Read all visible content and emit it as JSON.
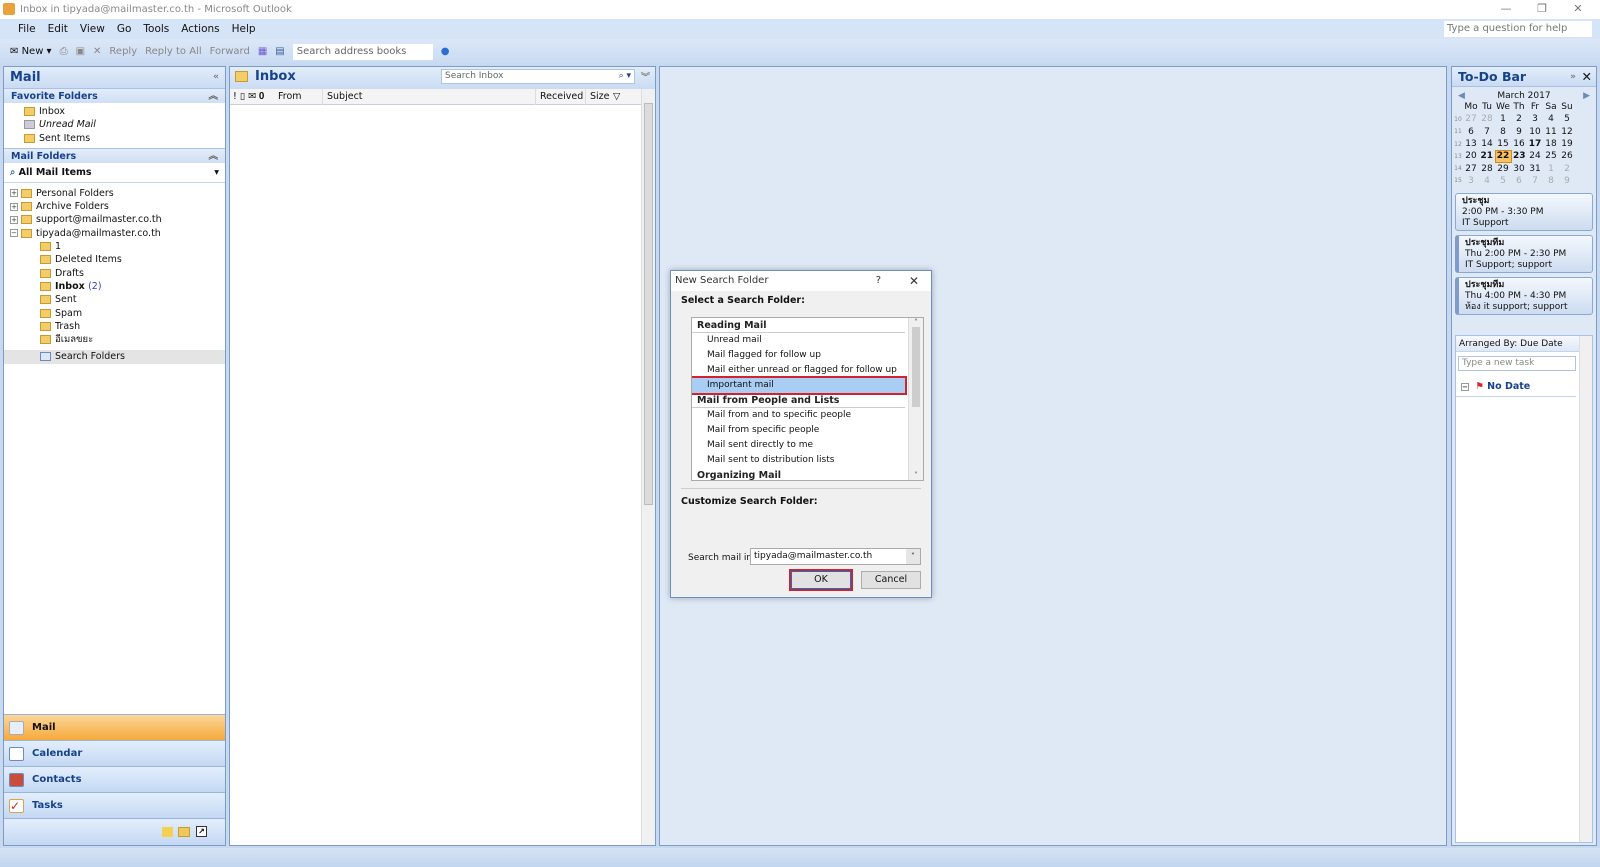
{
  "window": {
    "title": "Inbox in tipyada@mailmaster.co.th - Microsoft Outlook",
    "help_placeholder": "Type a question for help"
  },
  "menu": [
    "File",
    "Edit",
    "View",
    "Go",
    "Tools",
    "Actions",
    "Help"
  ],
  "toolbar": {
    "new": "New",
    "reply": "Reply",
    "reply_all": "Reply to All",
    "forward": "Forward",
    "address_search": "Search address books"
  },
  "nav": {
    "title": "Mail",
    "favorites_header": "Favorite Folders",
    "favorites": [
      {
        "label": "Inbox"
      },
      {
        "label": "Unread Mail"
      },
      {
        "label": "Sent Items"
      }
    ],
    "mail_folders_header": "Mail Folders",
    "all_items": "All Mail Items",
    "roots": [
      {
        "label": "Personal Folders",
        "exp": "+"
      },
      {
        "label": "Archive Folders",
        "exp": "+"
      },
      {
        "label": "support@mailmaster.co.th",
        "exp": "+"
      },
      {
        "label": "tipyada@mailmaster.co.th",
        "exp": "−"
      }
    ],
    "subfolders": [
      {
        "label": "1"
      },
      {
        "label": "Deleted Items"
      },
      {
        "label": "Drafts"
      },
      {
        "label": "Inbox",
        "count": "(2)"
      },
      {
        "label": "Sent"
      },
      {
        "label": "Spam"
      },
      {
        "label": "Trash"
      },
      {
        "label": "อีเมลขยะ"
      }
    ],
    "search_folders": "Search Folders",
    "buttons": [
      "Mail",
      "Calendar",
      "Contacts",
      "Tasks"
    ]
  },
  "inbox": {
    "title": "Inbox",
    "search_placeholder": "Search Inbox",
    "columns": [
      "From",
      "Subject",
      "Received",
      "Size"
    ]
  },
  "todo": {
    "title": "To-Do Bar",
    "month": "March 2017",
    "weekdays": [
      "Mo",
      "Tu",
      "We",
      "Th",
      "Fr",
      "Sa",
      "Su"
    ],
    "weeks": [
      {
        "wk": "10",
        "days": [
          "27",
          "28",
          "1",
          "2",
          "3",
          "4",
          "5"
        ]
      },
      {
        "wk": "11",
        "days": [
          "6",
          "7",
          "8",
          "9",
          "10",
          "11",
          "12"
        ]
      },
      {
        "wk": "12",
        "days": [
          "13",
          "14",
          "15",
          "16",
          "17",
          "18",
          "19"
        ]
      },
      {
        "wk": "13",
        "days": [
          "20",
          "21",
          "22",
          "23",
          "24",
          "25",
          "26"
        ]
      },
      {
        "wk": "14",
        "days": [
          "27",
          "28",
          "29",
          "30",
          "31",
          "1",
          "2"
        ]
      },
      {
        "wk": "15",
        "days": [
          "3",
          "4",
          "5",
          "6",
          "7",
          "8",
          "9"
        ]
      }
    ],
    "today": "22",
    "appointments": [
      {
        "title": "ประชุม",
        "time": "2:00 PM - 3:30 PM",
        "location": "IT Support"
      },
      {
        "title": "ประชุมทีม",
        "time": "Thu 2:00 PM - 2:30 PM",
        "location": "IT Support; support"
      },
      {
        "title": "ประชุมทีม",
        "time": "Thu 4:00 PM - 4:30 PM",
        "location": "ห้อง it support; support"
      }
    ],
    "tasks_arranged": "Arranged By: Due Date",
    "new_task_placeholder": "Type a new task",
    "no_date": "No Date"
  },
  "dialog": {
    "title": "New Search Folder",
    "help": "?",
    "select_label": "Select a Search Folder:",
    "groups": [
      {
        "name": "Reading Mail",
        "items": [
          "Unread mail",
          "Mail flagged for follow up",
          "Mail either unread or flagged for follow up",
          "Important mail"
        ]
      },
      {
        "name": "Mail from People and Lists",
        "items": [
          "Mail from and to specific people",
          "Mail from specific people",
          "Mail sent directly to me",
          "Mail sent to distribution lists"
        ]
      },
      {
        "name": "Organizing Mail",
        "items": []
      }
    ],
    "selected": "Important mail",
    "customize_label": "Customize Search Folder:",
    "search_in_label": "Search mail in:",
    "search_in_value": "tipyada@mailmaster.co.th",
    "ok": "OK",
    "cancel": "Cancel"
  },
  "colors": {
    "accent": "#15428b",
    "highlight": "#d3222b",
    "selected_nav": "#f8b94a"
  }
}
